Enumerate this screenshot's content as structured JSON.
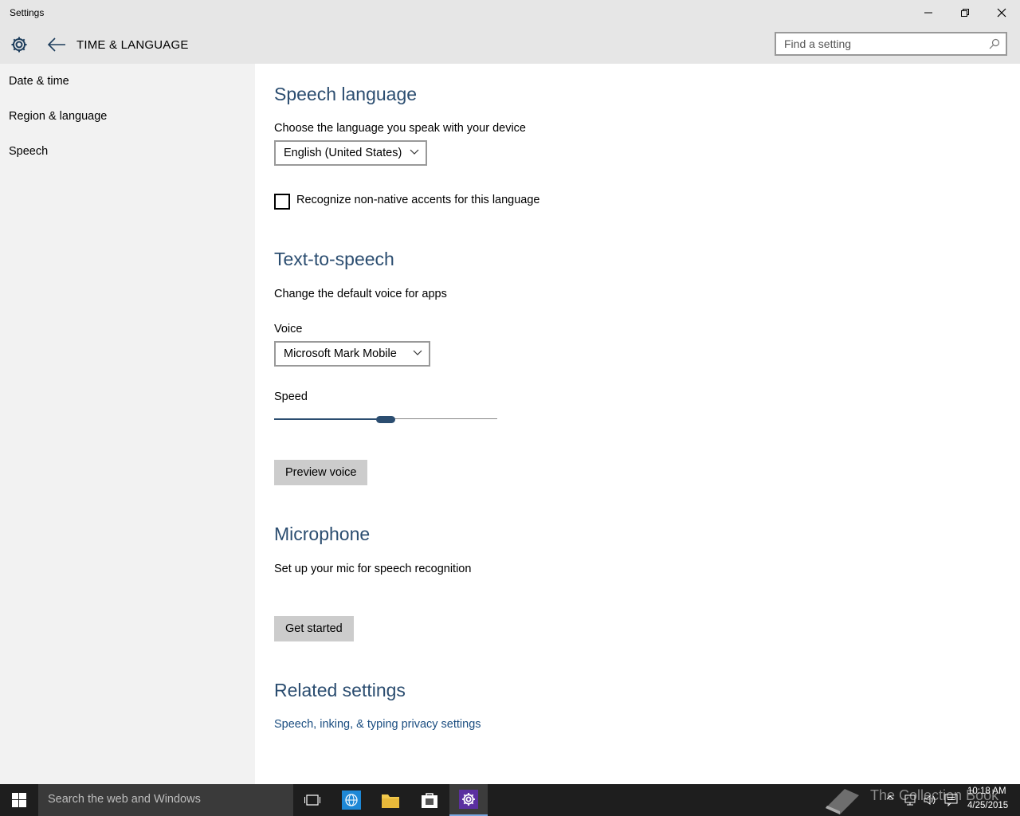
{
  "window": {
    "title": "Settings"
  },
  "header": {
    "section_title": "TIME & LANGUAGE",
    "search_placeholder": "Find a setting"
  },
  "sidebar": {
    "items": [
      {
        "label": "Date & time"
      },
      {
        "label": "Region & language"
      },
      {
        "label": "Speech"
      }
    ]
  },
  "speech_language": {
    "heading": "Speech language",
    "description": "Choose the language you speak with your device",
    "selected_language": "English (United States)",
    "checkbox_label": "Recognize non-native accents for this language",
    "checkbox_checked": false
  },
  "text_to_speech": {
    "heading": "Text-to-speech",
    "description": "Change the default voice for apps",
    "voice_label": "Voice",
    "selected_voice": "Microsoft Mark Mobile",
    "speed_label": "Speed",
    "speed_value_fraction": 0.5,
    "preview_button": "Preview voice"
  },
  "microphone": {
    "heading": "Microphone",
    "description": "Set up your mic for speech recognition",
    "get_started_button": "Get started"
  },
  "related": {
    "heading": "Related settings",
    "link": "Speech, inking, & typing privacy settings"
  },
  "taskbar": {
    "search_placeholder": "Search the web and Windows",
    "watermark": "The Collection Book",
    "time": "10:18 AM",
    "date": "4/25/2015"
  },
  "colors": {
    "accent": "#2b4d70",
    "link": "#1a4d80",
    "settings_app_tile": "#5b2fa0"
  }
}
